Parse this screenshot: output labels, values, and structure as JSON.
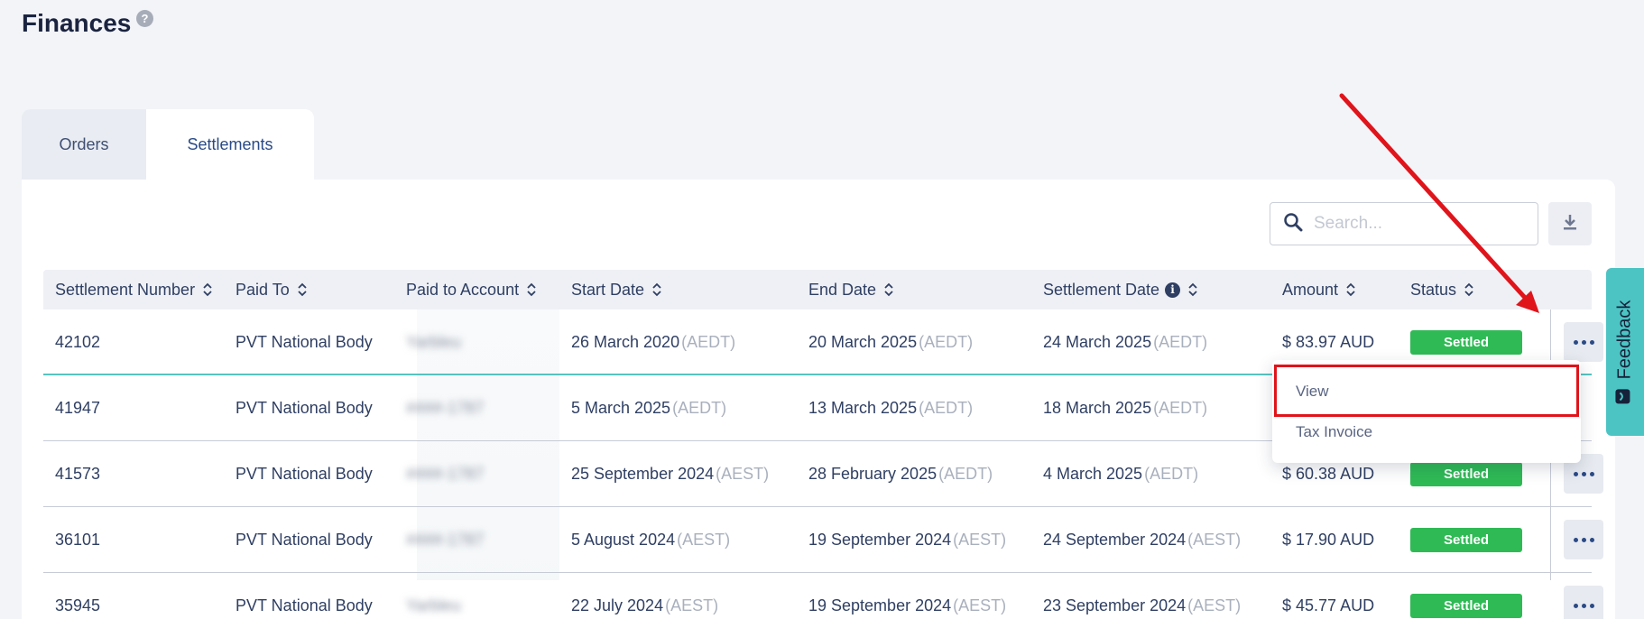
{
  "page": {
    "title": "Finances",
    "help_icon": "?"
  },
  "tabs": [
    {
      "label": "Orders",
      "active": false
    },
    {
      "label": "Settlements",
      "active": true
    }
  ],
  "search": {
    "placeholder": "Search...",
    "value": ""
  },
  "download": {
    "icon": "download-icon"
  },
  "table": {
    "columns": [
      "Settlement Number",
      "Paid To",
      "Paid to Account",
      "Start Date",
      "End Date",
      "Settlement Date",
      "Amount",
      "Status"
    ],
    "info_icon": "i",
    "rows": [
      {
        "number": "42102",
        "paid_to": "PVT National Body",
        "account": "Yarbleu",
        "start": "26 March 2020",
        "start_tz": "(AEDT)",
        "end": "20 March 2025",
        "end_tz": "(AEDT)",
        "settlement": "24 March 2025",
        "settlement_tz": "(AEDT)",
        "amount": "$ 83.97 AUD",
        "status": "Settled"
      },
      {
        "number": "41947",
        "paid_to": "PVT National Body",
        "account": "####-1787",
        "start": "5 March 2025",
        "start_tz": "(AEDT)",
        "end": "13 March 2025",
        "end_tz": "(AEDT)",
        "settlement": "18 March 2025",
        "settlement_tz": "(AEDT)",
        "amount": "",
        "status": ""
      },
      {
        "number": "41573",
        "paid_to": "PVT National Body",
        "account": "####-1787",
        "start": "25 September 2024",
        "start_tz": "(AEST)",
        "end": "28 February 2025",
        "end_tz": "(AEDT)",
        "settlement": "4 March 2025",
        "settlement_tz": "(AEDT)",
        "amount": "$ 60.38 AUD",
        "status": "Settled"
      },
      {
        "number": "36101",
        "paid_to": "PVT National Body",
        "account": "####-1787",
        "start": "5 August 2024",
        "start_tz": "(AEST)",
        "end": "19 September 2024",
        "end_tz": "(AEST)",
        "settlement": "24 September 2024",
        "settlement_tz": "(AEST)",
        "amount": "$ 17.90 AUD",
        "status": "Settled"
      },
      {
        "number": "35945",
        "paid_to": "PVT National Body",
        "account": "Yarbleu",
        "start": "22 July 2024",
        "start_tz": "(AEST)",
        "end": "19 September 2024",
        "end_tz": "(AEST)",
        "settlement": "23 September 2024",
        "settlement_tz": "(AEST)",
        "amount": "$ 45.77 AUD",
        "status": "Settled"
      }
    ]
  },
  "dropdown": {
    "items": [
      "View",
      "Tax Invoice"
    ]
  },
  "feedback": {
    "label": "Feedback"
  },
  "colors": {
    "settled": "#2fba55",
    "highlight": "#e0141b",
    "accent": "#4cc4c4"
  }
}
